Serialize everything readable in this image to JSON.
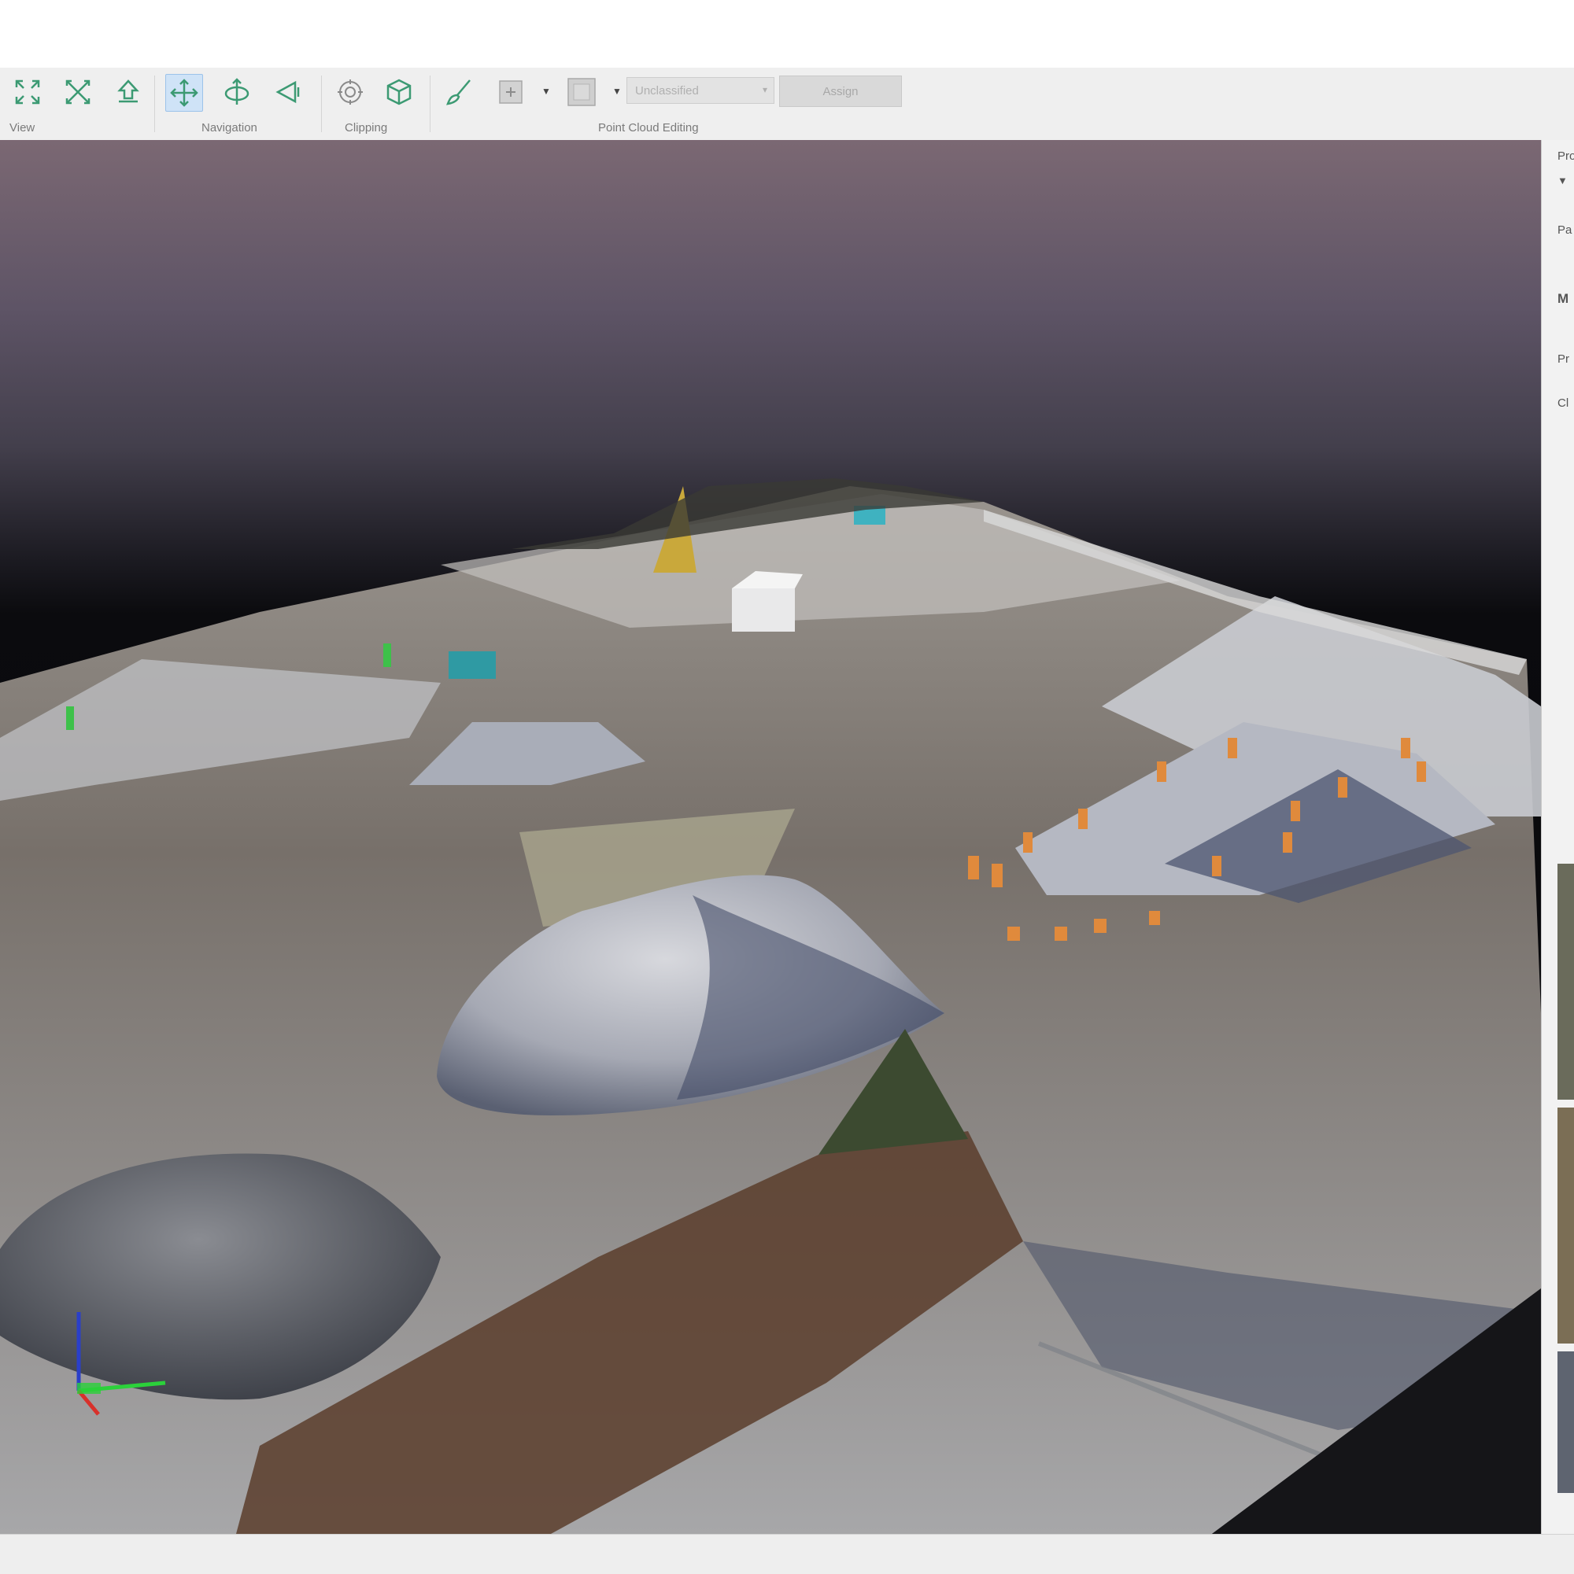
{
  "toolbar": {
    "groups": {
      "view": "View",
      "navigation": "Navigation",
      "clipping": "Clipping",
      "point_cloud_editing": "Point Cloud Editing"
    },
    "class_select_value": "Unclassified",
    "assign_label": "Assign"
  },
  "icons": {
    "zoom_extents": "expand-arrows-icon",
    "zoom_selection": "collapse-arrows-icon",
    "navigate_up": "up-arrow-navigation-icon",
    "pan": "four-way-pan-icon",
    "orbit": "orbit-axis-icon",
    "fly": "fly-triangle-icon",
    "clip_box": "clip-sphere-icon",
    "clip_cube": "clip-cube-icon",
    "brush": "brush-select-icon",
    "add_point": "add-point-icon",
    "color_swatch": "color-swatch-icon"
  },
  "right_panel": {
    "labels": [
      "Pro",
      "Pa",
      "M",
      "Pr",
      "Cl"
    ]
  },
  "colors": {
    "ribbon_bg": "#efefef",
    "active_tool": "#cfe3f7",
    "icon_green": "#3c9a73",
    "axis_x": "#2bd13a",
    "axis_y": "#2a3fc9",
    "axis_z": "#d8312b"
  }
}
